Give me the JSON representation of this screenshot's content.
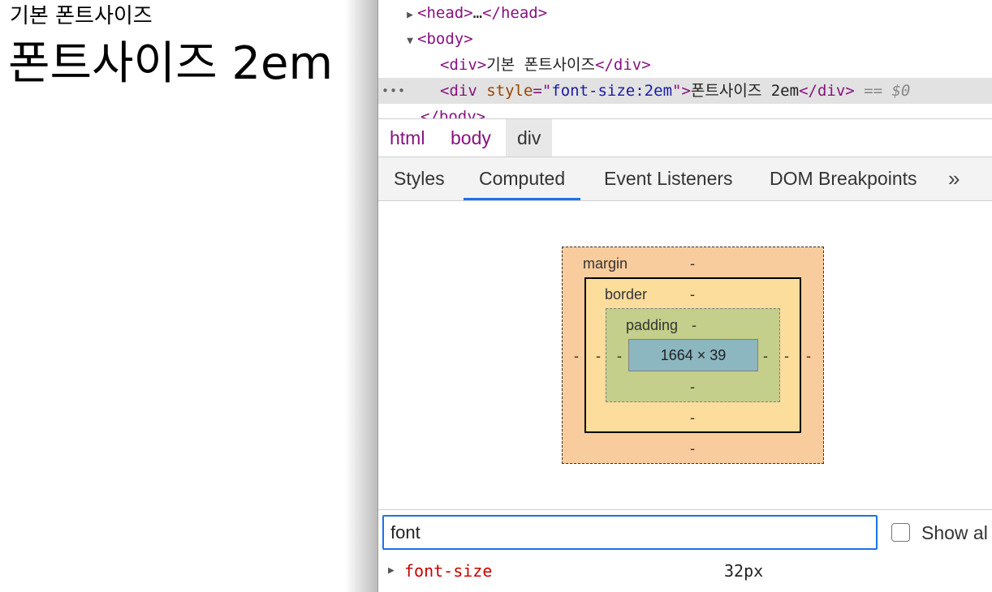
{
  "page": {
    "line1": "기본 폰트사이즈",
    "line2": "폰트사이즈 2em"
  },
  "dom": {
    "head_open": "<head>",
    "head_ellipsis": "…",
    "head_close": "</head>",
    "body_open": "<body>",
    "div1_open": "<div>",
    "div1_text": "기본 폰트사이즈",
    "div1_close": "</div>",
    "div2_open": "<div ",
    "div2_attr_name": "style",
    "div2_attr_eq": "=\"",
    "div2_attr_value": "font-size:2em",
    "div2_attr_end": "\">",
    "div2_text": "폰트사이즈 2em",
    "div2_close": "</div>",
    "selected_marker_prefix": " == ",
    "selected_marker_var": "$0",
    "body_close": "</body>",
    "more_dots": "•••"
  },
  "breadcrumb": [
    "html",
    "body",
    "div"
  ],
  "tabs": [
    "Styles",
    "Computed",
    "Event Listeners",
    "DOM Breakpoints"
  ],
  "tabs_more": "»",
  "active_tab": "Computed",
  "box_model": {
    "margin_label": "margin",
    "border_label": "border",
    "padding_label": "padding",
    "dash": "-",
    "content_size": "1664 × 39"
  },
  "filter": {
    "value": "font",
    "show_all_label": "Show al"
  },
  "computed_props": [
    {
      "name": "font-size",
      "value": "32px"
    }
  ]
}
